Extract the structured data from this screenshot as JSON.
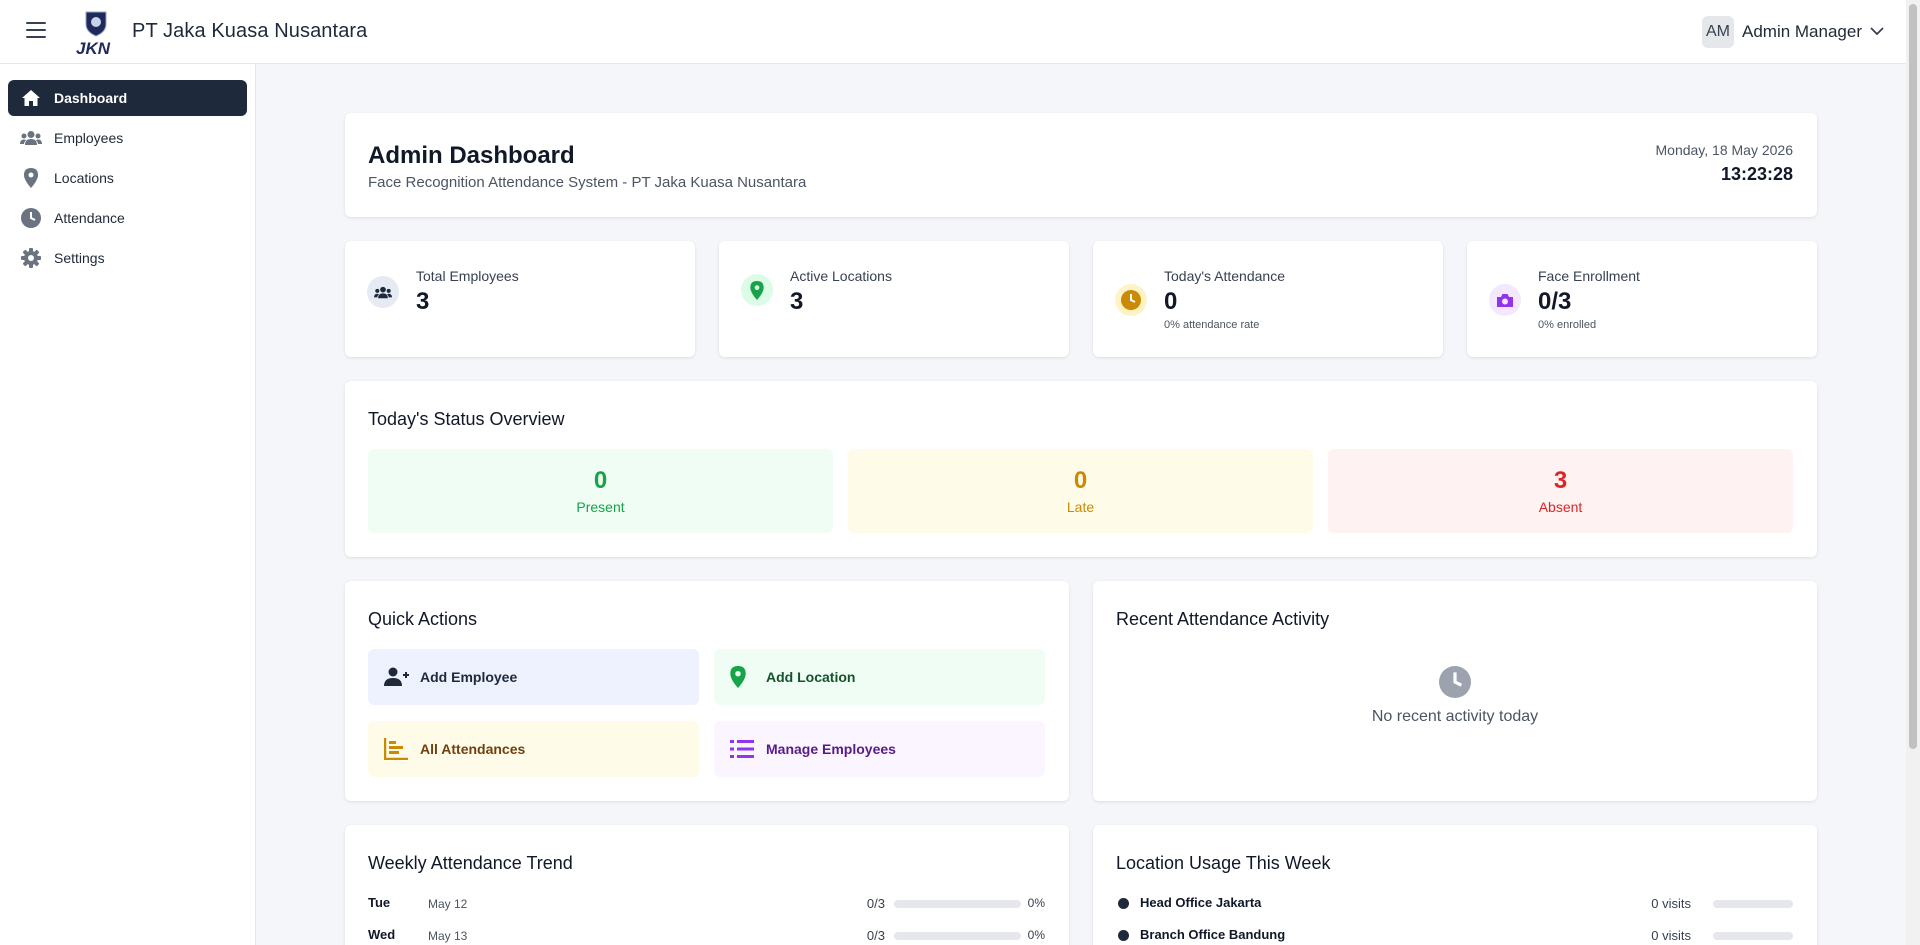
{
  "header": {
    "brand": "PT Jaka Kuasa Nusantara",
    "logo_text": "JKN",
    "user_initials": "AM",
    "user_name": "Admin Manager"
  },
  "sidebar": {
    "items": [
      {
        "label": "Dashboard",
        "icon": "home-icon",
        "active": true
      },
      {
        "label": "Employees",
        "icon": "users-icon"
      },
      {
        "label": "Locations",
        "icon": "map-pin-icon"
      },
      {
        "label": "Attendance",
        "icon": "clock-icon"
      },
      {
        "label": "Settings",
        "icon": "gear-icon"
      }
    ]
  },
  "page": {
    "title": "Admin Dashboard",
    "subtitle": "Face Recognition Attendance System - PT Jaka Kuasa Nusantara",
    "date": "Monday, 18 May 2026",
    "time": "13:23:28"
  },
  "stats": [
    {
      "label": "Total Employees",
      "value": "3",
      "note": "",
      "icon": "users-icon",
      "color": "#1e293b",
      "bg": "#e5eaf3"
    },
    {
      "label": "Active Locations",
      "value": "3",
      "note": "",
      "icon": "map-pin-icon",
      "color": "#16a34a",
      "bg": "#dcfce7"
    },
    {
      "label": "Today's Attendance",
      "value": "0",
      "note": "0% attendance rate",
      "icon": "clock-icon",
      "color": "#ca8a04",
      "bg": "#fef3c7"
    },
    {
      "label": "Face Enrollment",
      "value": "0/3",
      "note": "0% enrolled",
      "icon": "camera-icon",
      "color": "#9333ea",
      "bg": "#f3e8ff"
    }
  ],
  "status_overview": {
    "title": "Today's Status Overview",
    "present": {
      "value": "0",
      "label": "Present",
      "color": "#16a34a",
      "bg": "#f0fdf4"
    },
    "late": {
      "value": "0",
      "label": "Late",
      "color": "#ca8a04",
      "bg": "#fefce8"
    },
    "absent": {
      "value": "3",
      "label": "Absent",
      "color": "#dc2626",
      "bg": "#fef2f2"
    }
  },
  "quick_actions": {
    "title": "Quick Actions",
    "add_employee": "Add Employee",
    "add_location": "Add Location",
    "all_attendances": "All Attendances",
    "manage_employees": "Manage Employees"
  },
  "recent_activity": {
    "title": "Recent Attendance Activity",
    "empty": "No recent activity today"
  },
  "weekly_trend": {
    "title": "Weekly Attendance Trend",
    "rows": [
      {
        "day": "Tue",
        "date": "May 12",
        "count": "0/3",
        "pct": "0%",
        "fraction": 0
      },
      {
        "day": "Wed",
        "date": "May 13",
        "count": "0/3",
        "pct": "0%",
        "fraction": 0
      }
    ]
  },
  "location_usage": {
    "title": "Location Usage This Week",
    "rows": [
      {
        "name": "Head Office Jakarta",
        "visits": "0 visits",
        "fraction": 0
      },
      {
        "name": "Branch Office Bandung",
        "visits": "0 visits",
        "fraction": 0
      }
    ]
  }
}
